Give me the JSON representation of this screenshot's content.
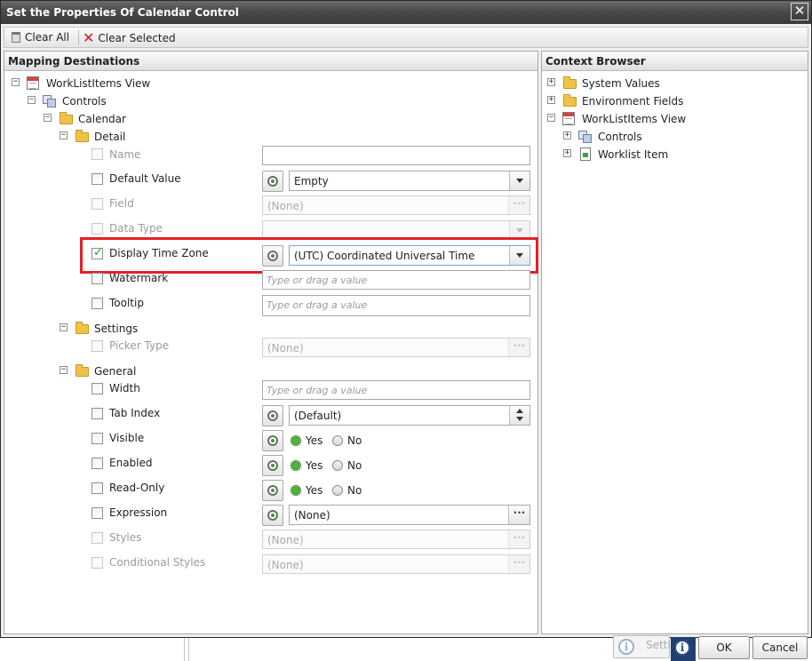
{
  "dialog": {
    "title": "Set the Properties Of Calendar Control",
    "close_glyph": "✕"
  },
  "toolbar": {
    "clear_all": "Clear All",
    "clear_selected": "Clear Selected",
    "clear_all_icon": "trash-icon",
    "clear_selected_icon": "red-x-icon"
  },
  "mapping": {
    "header": "Mapping Destinations",
    "root": "WorkListItems View",
    "controls": "Controls",
    "calendar": "Calendar",
    "sections": {
      "detail": "Detail",
      "settings": "Settings",
      "general": "General"
    },
    "props": {
      "name": {
        "label": "Name"
      },
      "default_value": {
        "label": "Default Value",
        "value": "Empty"
      },
      "field": {
        "label": "Field",
        "value": "(None)"
      },
      "data_type": {
        "label": "Data Type"
      },
      "display_time_zone": {
        "label": "Display Time Zone",
        "value": "(UTC) Coordinated Universal Time",
        "checked": true
      },
      "watermark": {
        "label": "Watermark",
        "placeholder": "Type or drag a value"
      },
      "tooltip": {
        "label": "Tooltip",
        "placeholder": "Type or drag a value"
      },
      "picker_type": {
        "label": "Picker Type",
        "value": "(None)"
      },
      "width": {
        "label": "Width",
        "placeholder": "Type or drag a value"
      },
      "tab_index": {
        "label": "Tab Index",
        "value": "(Default)"
      },
      "visible": {
        "label": "Visible",
        "yes": "Yes",
        "no": "No",
        "selected": "Yes"
      },
      "enabled": {
        "label": "Enabled",
        "yes": "Yes",
        "no": "No",
        "selected": "Yes"
      },
      "read_only": {
        "label": "Read-Only",
        "yes": "Yes",
        "no": "No",
        "selected": "Yes"
      },
      "expression": {
        "label": "Expression",
        "value": "(None)"
      },
      "styles": {
        "label": "Styles",
        "value": "(None)"
      },
      "conditional_styles": {
        "label": "Conditional Styles",
        "value": "(None)"
      }
    },
    "ellipsis": "···"
  },
  "context": {
    "header": "Context Browser",
    "items": {
      "system_values": "System Values",
      "environment_fields": "Environment Fields",
      "worklistitems_view": "WorkListItems View",
      "controls": "Controls",
      "worklist_item": "Worklist Item"
    }
  },
  "footer": {
    "ok": "OK",
    "cancel": "Cancel",
    "background_button": "Setti",
    "info_icon_glyph": "i"
  },
  "tree_glyphs": {
    "expanded": "−",
    "collapsed": "+"
  },
  "colors": {
    "highlight": "#e4202a",
    "check": "#239a23",
    "radio_on": "#4cb835",
    "titlebar": "#4a4a4a"
  }
}
